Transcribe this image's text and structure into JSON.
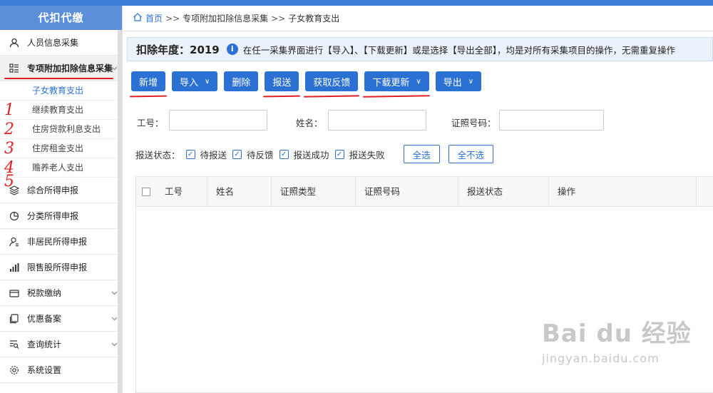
{
  "app": {
    "logo": "代扣代缴"
  },
  "sidebar": {
    "items": [
      {
        "label": "人员信息采集",
        "icon": "person-icon"
      },
      {
        "label": "专项附加扣除信息采集",
        "icon": "list-icon",
        "expanded": true
      },
      {
        "label": "综合所得申报",
        "icon": "layers-icon"
      },
      {
        "label": "分类所得申报",
        "icon": "pie-icon"
      },
      {
        "label": "非居民所得申报",
        "icon": "person-gear-icon"
      },
      {
        "label": "限售股所得申报",
        "icon": "bar-chart-icon"
      },
      {
        "label": "税款缴纳",
        "icon": "wallet-icon"
      },
      {
        "label": "优惠备案",
        "icon": "copy-icon"
      },
      {
        "label": "查询统计",
        "icon": "search-list-icon"
      },
      {
        "label": "系统设置",
        "icon": "gear-icon"
      }
    ],
    "sub_items": [
      {
        "label": "子女教育支出",
        "annotation": ""
      },
      {
        "label": "继续教育支出",
        "annotation": "1"
      },
      {
        "label": "住房贷款利息支出",
        "annotation": "2"
      },
      {
        "label": "住房租金支出",
        "annotation": "3"
      },
      {
        "label": "赡养老人支出",
        "annotation": "4"
      }
    ],
    "extra_annotation": "5"
  },
  "breadcrumb": {
    "home": "首页",
    "sep": ">>",
    "level1": "专项附加扣除信息采集",
    "level2": "子女教育支出"
  },
  "yearbar": {
    "label": "扣除年度：2019",
    "info_icon": "i",
    "message": "在任一采集界面进行【导入】、【下载更新】或是选择【导出全部】，均是对所有采集项目的操作，无需重复操作"
  },
  "toolbar": {
    "add": "新增",
    "import": "导入",
    "delete": "删除",
    "submit": "报送",
    "feedback": "获取反馈",
    "download": "下载更新",
    "export": "导出"
  },
  "filters": {
    "employee_id_label": "工号：",
    "name_label": "姓名：",
    "id_number_label": "证照号码：",
    "employee_id_value": "",
    "name_value": "",
    "id_number_value": ""
  },
  "status": {
    "label": "报送状态：",
    "options": [
      "待报送",
      "待反馈",
      "报送成功",
      "报送失败"
    ],
    "select_all": "全选",
    "select_none": "全不选"
  },
  "table": {
    "columns": [
      "工号",
      "姓名",
      "证照类型",
      "证照号码",
      "报送状态",
      "操作"
    ]
  },
  "watermark": {
    "brand": "Bai du 经验",
    "url": "jingyan.baidu.com"
  },
  "colors": {
    "primary": "#2b71d3",
    "annotation": "#e02020",
    "logo_bg": "#5b8fd9"
  }
}
